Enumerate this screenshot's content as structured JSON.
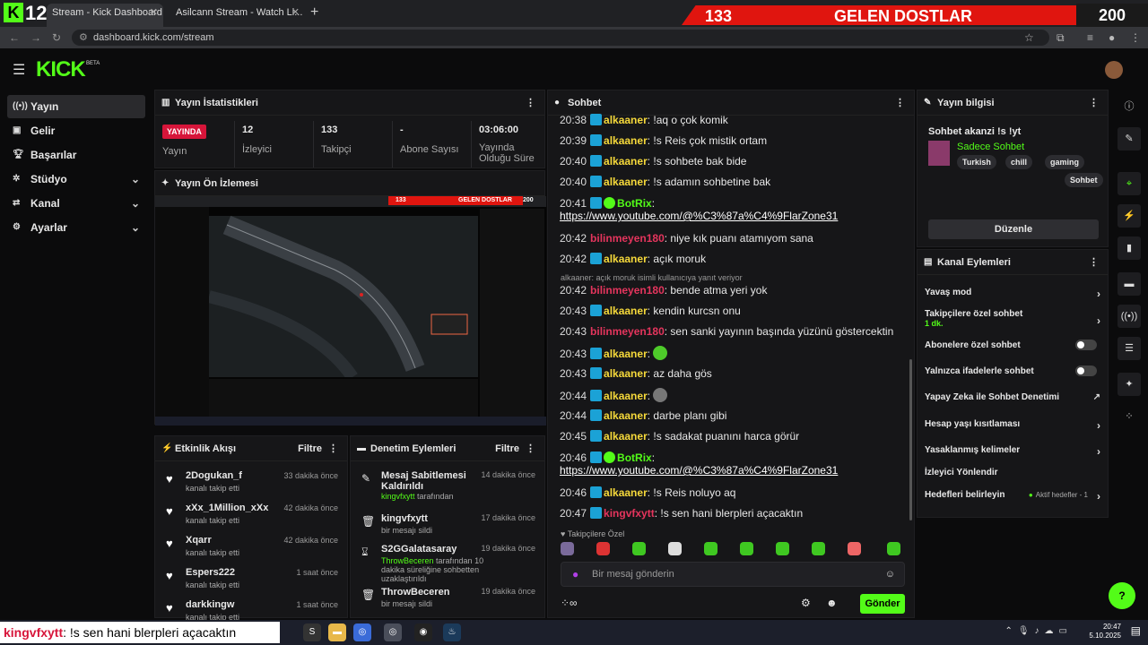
{
  "browser": {
    "overlay_count": "12",
    "tabs": [
      {
        "title": "Stream - Kick Dashboard"
      },
      {
        "title": "Asilcann Stream - Watch Li..."
      }
    ],
    "url": "dashboard.kick.com/stream"
  },
  "overlay": {
    "left_number": "133",
    "title": "GELEN DOSTLAR",
    "right_number": "200"
  },
  "header": {
    "logo": "KICK",
    "beta": "BETA"
  },
  "sidebar": {
    "items": [
      {
        "label": "Yayın",
        "icon": "broadcast-icon"
      },
      {
        "label": "Gelir",
        "icon": "revenue-icon"
      },
      {
        "label": "Başarılar",
        "icon": "trophy-icon"
      },
      {
        "label": "Stüdyo",
        "icon": "studio-icon"
      },
      {
        "label": "Kanal",
        "icon": "channel-icon"
      },
      {
        "label": "Ayarlar",
        "icon": "gear-icon"
      }
    ]
  },
  "stats": {
    "title": "Yayın İstatistikleri",
    "live_badge": "YAYINDA",
    "items": [
      {
        "value": "",
        "label": "Yayın"
      },
      {
        "value": "12",
        "label": "İzleyici"
      },
      {
        "value": "133",
        "label": "Takipçi"
      },
      {
        "value": "-",
        "label": "Abone Sayısı"
      },
      {
        "value": "03:06:00",
        "label": "Yayında Olduğu Süre"
      }
    ]
  },
  "preview": {
    "title": "Yayın Ön İzlemesi",
    "mini_banner_left": "133",
    "mini_banner_title": "GELEN DOSTLAR",
    "mini_banner_right": "200"
  },
  "activity": {
    "title": "Etkinlik Akışı",
    "filter": "Filtre",
    "items": [
      {
        "name": "2Dogukan_f",
        "sub": "kanalı takip etti",
        "time": "33 dakika önce"
      },
      {
        "name": "xXx_1Million_xXx",
        "sub": "kanalı takip etti",
        "time": "42 dakika önce"
      },
      {
        "name": "Xqarr",
        "sub": "kanalı takip etti",
        "time": "42 dakika önce"
      },
      {
        "name": "Espers222",
        "sub": "kanalı takip etti",
        "time": "1 saat önce"
      },
      {
        "name": "darkkingw",
        "sub": "kanalı takip etti",
        "time": "1 saat önce"
      }
    ]
  },
  "moderation": {
    "title": "Denetim Eylemleri",
    "filter": "Filtre",
    "items": [
      {
        "title": "Mesaj Sabitlemesi Kaldırıldı",
        "actor": "kingvfxytt",
        "rest": " tarafından",
        "time": "14 dakika önce",
        "icon": "pin-icon"
      },
      {
        "title": "kingvfxytt",
        "actor": "",
        "rest": "bir mesajı sildi",
        "time": "17 dakika önce",
        "icon": "trash-icon"
      },
      {
        "title": "S2GGalatasaray",
        "actor": "ThrowBeceren",
        "rest": " tarafından 10 dakika süreliğine sohbetten uzaklaştırıldı",
        "time": "19 dakika önce",
        "icon": "hourglass-icon"
      },
      {
        "title": "ThrowBeceren",
        "actor": "",
        "rest": "bir mesajı sildi",
        "time": "19 dakika önce",
        "icon": "trash-icon"
      }
    ]
  },
  "chat": {
    "title": "Sohbet",
    "messages": [
      {
        "time": "20:38",
        "user": "alkaaner",
        "color": "yel",
        "text": ": !aq o çok komik"
      },
      {
        "time": "20:39",
        "user": "alkaaner",
        "color": "yel",
        "text": ": !s Reis çok mistik ortam"
      },
      {
        "time": "20:40",
        "user": "alkaaner",
        "color": "yel",
        "text": ": !s sohbete bak bide"
      },
      {
        "time": "20:40",
        "user": "alkaaner",
        "color": "yel",
        "text": ": !s adamın sohbetine bak"
      },
      {
        "time": "20:41",
        "user": "BotRix",
        "color": "grn",
        "text": ":"
      },
      {
        "time": "20:42",
        "user": "bilinmeyen180",
        "color": "red",
        "text": ": niye kık puanı atamıyom sana"
      },
      {
        "time": "20:42",
        "user": "alkaaner",
        "color": "yel",
        "text": ": açık moruk"
      },
      {
        "time": "20:42",
        "user": "bilinmeyen180",
        "color": "red",
        "text": ": bende atma yeri yok"
      },
      {
        "time": "20:43",
        "user": "alkaaner",
        "color": "yel",
        "text": ": kendin kurcsn onu"
      },
      {
        "time": "20:43",
        "user": "bilinmeyen180",
        "color": "red",
        "text": ": sen sanki yayının başında yüzünü göstercektin"
      },
      {
        "time": "20:43",
        "user": "alkaaner",
        "color": "yel",
        "text": ":"
      },
      {
        "time": "20:43",
        "user": "alkaaner",
        "color": "yel",
        "text": ": az daha gös"
      },
      {
        "time": "20:44",
        "user": "alkaaner",
        "color": "yel",
        "text": ":"
      },
      {
        "time": "20:44",
        "user": "alkaaner",
        "color": "yel",
        "text": ": darbe planı gibi"
      },
      {
        "time": "20:45",
        "user": "alkaaner",
        "color": "yel",
        "text": ": !s sadakat puanını harca görür"
      },
      {
        "time": "20:46",
        "user": "BotRix",
        "color": "grn",
        "text": ":"
      },
      {
        "time": "20:46",
        "user": "alkaaner",
        "color": "yel",
        "text": ": !s Reis noluyo aq"
      },
      {
        "time": "20:47",
        "user": "kingvfxytt",
        "color": "red",
        "text": ": !s sen hani blerpleri açacaktın"
      }
    ],
    "link": "https://www.youtube.com/@%C3%87a%C4%9FlarZone31",
    "reply_note": "alkaaner: açık moruk isimli kullanıcıya yanıt veriyor",
    "sub_only": "Takipçilere Özel",
    "input_placeholder": "Bir mesaj gönderin",
    "send": "Gönder"
  },
  "info": {
    "title": "Yayın bilgisi",
    "stream_title": "Sohbet akanzi !s !yt",
    "category": "Sadece Sohbet",
    "tags": [
      "Turkish",
      "chill",
      "gaming",
      "Sohbet"
    ],
    "edit": "Düzenle"
  },
  "channel_actions": {
    "title": "Kanal Eylemleri",
    "items": [
      {
        "label": "Yavaş mod",
        "sub": "",
        "control": "arrow"
      },
      {
        "label": "Takipçilere özel sohbet",
        "sub": "1 dk.",
        "control": "arrow"
      },
      {
        "label": "Abonelere özel sohbet",
        "sub": "",
        "control": "toggle"
      },
      {
        "label": "Yalnızca ifadelerle sohbet",
        "sub": "",
        "control": "toggle"
      },
      {
        "label": "Yapay Zeka ile Sohbet Denetimi",
        "sub": "",
        "control": "external"
      },
      {
        "label": "Hesap yaşı kısıtlaması",
        "sub": "",
        "control": "arrow"
      },
      {
        "label": "Yasaklanmış kelimeler",
        "sub": "",
        "control": "arrow"
      },
      {
        "label": "İzleyici Yönlendir",
        "sub": "",
        "control": "none"
      },
      {
        "label": "Hedefleri belirleyin",
        "sub": "",
        "control": "arrow"
      }
    ],
    "goal_sub": "Aktif hedefler - 1"
  },
  "taskbar": {
    "ticker_user": "kingvfxytt",
    "ticker_text": ": !s sen hani blerpleri açacaktın",
    "time": "20:47",
    "date": "5.10.2025"
  }
}
